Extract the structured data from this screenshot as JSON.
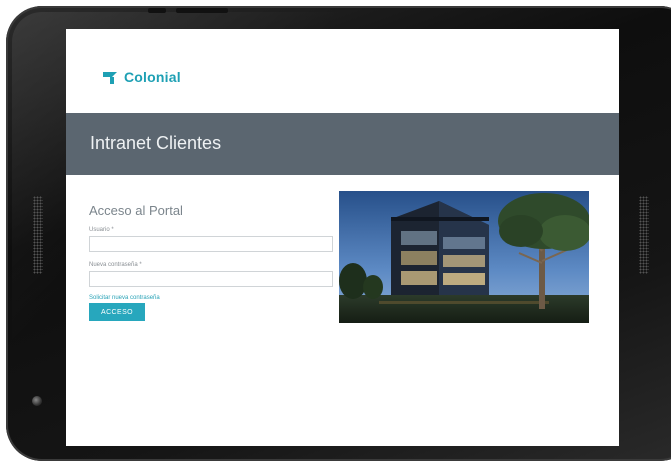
{
  "brand": {
    "name": "Colonial"
  },
  "banner": {
    "title": "Intranet Clientes"
  },
  "login": {
    "title": "Acceso al Portal",
    "username_label": "Usuario *",
    "username_value": "",
    "password_label": "Nueva contraseña *",
    "password_value": "",
    "request_password_link": "Solicitar nueva contraseña",
    "submit_label": "ACCESO"
  },
  "colors": {
    "accent": "#27a7bd",
    "banner_bg": "#5b6670",
    "frame": "#151515"
  },
  "icons": [
    "colonial-logo-icon",
    "building-photo"
  ]
}
